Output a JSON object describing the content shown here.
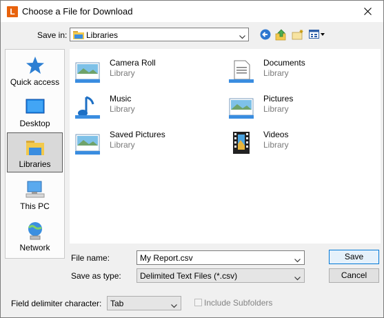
{
  "window": {
    "app_icon_letter": "L",
    "title": "Choose a File for Download"
  },
  "toolbar": {
    "save_in_label": "Save in:",
    "location": "Libraries",
    "icons": [
      "back-icon",
      "up-folder-icon",
      "new-folder-icon",
      "view-menu-icon"
    ]
  },
  "places": [
    {
      "label": "Quick access",
      "icon": "star-icon"
    },
    {
      "label": "Desktop",
      "icon": "desktop-icon"
    },
    {
      "label": "Libraries",
      "icon": "libraries-icon",
      "selected": true
    },
    {
      "label": "This PC",
      "icon": "computer-icon"
    },
    {
      "label": "Network",
      "icon": "network-icon"
    }
  ],
  "items": [
    {
      "name": "Camera Roll",
      "type": "Library",
      "icon": "picture-library-icon"
    },
    {
      "name": "Documents",
      "type": "Library",
      "icon": "document-library-icon"
    },
    {
      "name": "Music",
      "type": "Library",
      "icon": "music-icon"
    },
    {
      "name": "Pictures",
      "type": "Library",
      "icon": "picture-library-icon"
    },
    {
      "name": "Saved Pictures",
      "type": "Library",
      "icon": "picture-library-icon"
    },
    {
      "name": "Videos",
      "type": "Library",
      "icon": "video-library-icon"
    }
  ],
  "form": {
    "file_name_label": "File name:",
    "file_name_value": "My Report.csv",
    "save_as_type_label": "Save as type:",
    "save_as_type_value": "Delimited Text Files (*.csv)",
    "delimiter_label": "Field delimiter character:",
    "delimiter_value": "Tab",
    "include_subfolders_label": "Include Subfolders",
    "include_subfolders_checked": false
  },
  "buttons": {
    "save": "Save",
    "cancel": "Cancel"
  },
  "colors": {
    "app_icon": "#e8620c",
    "default_button_border": "#0078d7"
  }
}
